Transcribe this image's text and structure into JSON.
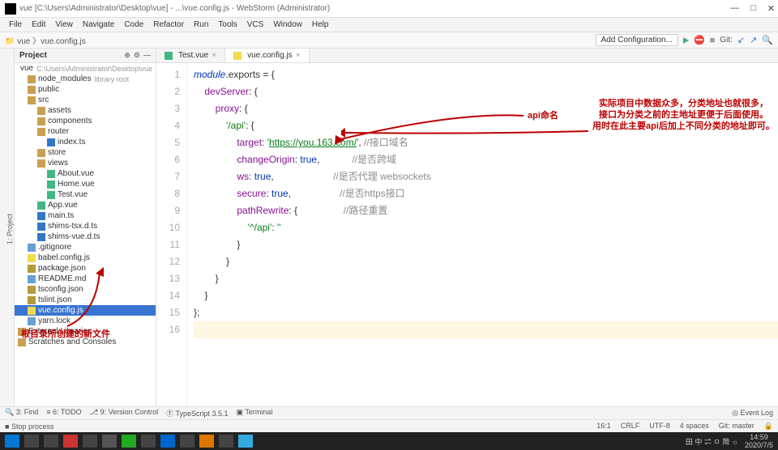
{
  "title": "vue [C:\\Users\\Administrator\\Desktop\\vue] - ...\\vue.config.js - WebStorm (Administrator)",
  "menus": [
    "File",
    "Edit",
    "View",
    "Navigate",
    "Code",
    "Refactor",
    "Run",
    "Tools",
    "VCS",
    "Window",
    "Help"
  ],
  "breadcrumb": "vue 〉vue.config.js",
  "add_config": "Add Configuration...",
  "git_label": "Git:",
  "panel_title": "Project",
  "tree": [
    {
      "d": 0,
      "icon": "folder-icon",
      "label": "vue",
      "hint": "C:\\Users\\Administrator\\Desktop\\vue"
    },
    {
      "d": 1,
      "icon": "folder-icon",
      "label": "node_modules",
      "hint": "library root"
    },
    {
      "d": 1,
      "icon": "folder-icon",
      "label": "public"
    },
    {
      "d": 1,
      "icon": "folder-icon",
      "label": "src"
    },
    {
      "d": 2,
      "icon": "folder-icon",
      "label": "assets"
    },
    {
      "d": 2,
      "icon": "folder-icon",
      "label": "components"
    },
    {
      "d": 2,
      "icon": "folder-icon",
      "label": "router"
    },
    {
      "d": 3,
      "icon": "ts-icon",
      "label": "index.ts"
    },
    {
      "d": 2,
      "icon": "folder-icon",
      "label": "store"
    },
    {
      "d": 2,
      "icon": "folder-icon",
      "label": "views"
    },
    {
      "d": 3,
      "icon": "vue-icon",
      "label": "About.vue"
    },
    {
      "d": 3,
      "icon": "vue-icon",
      "label": "Home.vue"
    },
    {
      "d": 3,
      "icon": "vue-icon",
      "label": "Test.vue"
    },
    {
      "d": 2,
      "icon": "vue-icon",
      "label": "App.vue"
    },
    {
      "d": 2,
      "icon": "ts-icon",
      "label": "main.ts"
    },
    {
      "d": 2,
      "icon": "ts-icon",
      "label": "shims-tsx.d.ts"
    },
    {
      "d": 2,
      "icon": "ts-icon",
      "label": "shims-vue.d.ts"
    },
    {
      "d": 1,
      "icon": "file-icon",
      "label": ".gitignore"
    },
    {
      "d": 1,
      "icon": "js-icon",
      "label": "babel.config.js"
    },
    {
      "d": 1,
      "icon": "json-icon",
      "label": "package.json"
    },
    {
      "d": 1,
      "icon": "file-icon",
      "label": "README.md"
    },
    {
      "d": 1,
      "icon": "json-icon",
      "label": "tsconfig.json"
    },
    {
      "d": 1,
      "icon": "json-icon",
      "label": "tslint.json"
    },
    {
      "d": 1,
      "icon": "js-icon",
      "label": "vue.config.js",
      "selected": true
    },
    {
      "d": 1,
      "icon": "file-icon",
      "label": "yarn.lock"
    },
    {
      "d": 0,
      "icon": "folder-icon",
      "label": "External Libraries"
    },
    {
      "d": 0,
      "icon": "folder-icon",
      "label": "Scratches and Consoles"
    }
  ],
  "tabs": [
    {
      "label": "Test.vue",
      "icon": "vue-icon"
    },
    {
      "label": "vue.config.js",
      "icon": "js-icon",
      "active": true
    }
  ],
  "code_lines": 16,
  "code": {
    "l1": "module.exports = {",
    "l2": "    devServer: {",
    "l3": "        proxy: {",
    "l4": "            '/api': {",
    "l5a": "                target: '",
    "l5b": "https://you.163.com/",
    "l5c": "', ",
    "c5": "//接口域名",
    "l6": "                changeOrigin: true,            ",
    "c6": "//是否跨域",
    "l7": "                ws: true,                      ",
    "c7": "//是否代理 websockets",
    "l8": "                secure: true,                  ",
    "c8": "//是否https接口",
    "l9": "                pathRewrite: {                 ",
    "c9": "//路径重置",
    "l10": "                    '^/api': ''",
    "l11": "                }",
    "l12": "            }",
    "l13": "        }",
    "l14": "    }",
    "l15": "};"
  },
  "annotation1": "api命名",
  "annotation2_l1": "实际项目中数据众多，分类地址也就很多，",
  "annotation2_l2": "接口为分类之前的主地址更便于后面使用。",
  "annotation2_l3": "用时在此主要api后加上不同分类的地址即可。",
  "bottom_annotation": "根目录所创建的新文件",
  "status_bottom": {
    "find": "3: Find",
    "todo": "6: TODO",
    "vcs": "9: Version Control",
    "ts": "TypeScript 3.5.1",
    "terminal": "Terminal",
    "eventlog": "Event Log"
  },
  "status2": {
    "stop": "Stop process",
    "pos": "16:1",
    "crlf": "CRLF",
    "enc": "UTF-8",
    "indent": "4 spaces",
    "git": "Git: master"
  },
  "taskbar_time": "14:59",
  "taskbar_date": "2020/7/5",
  "taskbar_ime": "田 中 ⇌ ㅁ 简 ☼"
}
